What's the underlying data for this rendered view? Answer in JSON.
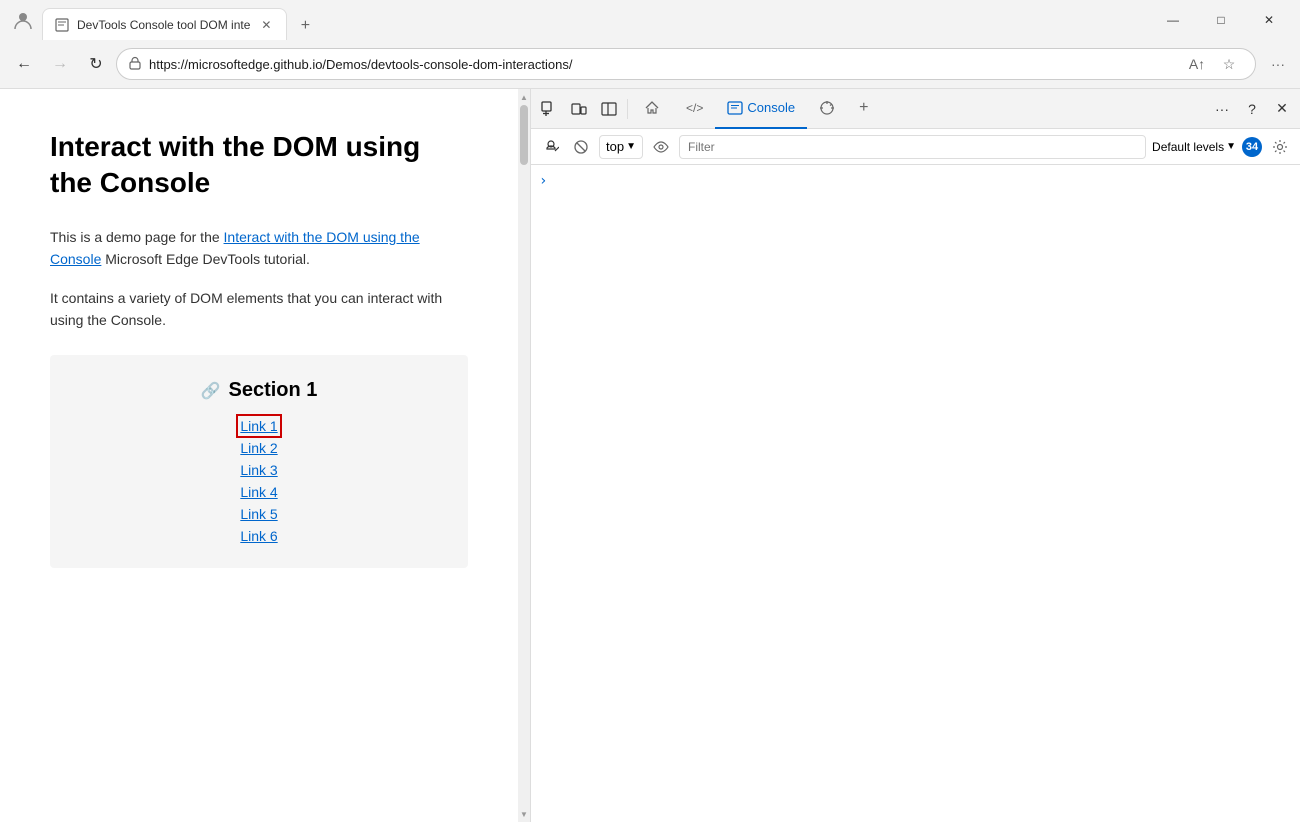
{
  "browser": {
    "tab_title": "DevTools Console tool DOM inte",
    "tab_favicon": "📄",
    "new_tab_icon": "+",
    "window_controls": {
      "minimize": "—",
      "maximize": "□",
      "close": "✕"
    }
  },
  "navbar": {
    "back_label": "←",
    "forward_label": "→",
    "refresh_label": "↻",
    "url": "https://microsoftedge.github.io/Demos/devtools-console-dom-interactions/",
    "url_readable_prefix": "https://",
    "url_domain": "microsoftedge.github.io",
    "url_path": "/Demos/devtools-console-dom-interactions/",
    "read_aloud_icon": "A↑",
    "favorites_icon": "☆",
    "more_icon": "···"
  },
  "webpage": {
    "heading": "Interact with the DOM using the Console",
    "paragraph1_prefix": "This is a demo page for the ",
    "paragraph1_link": "Interact with the DOM using the Console",
    "paragraph1_suffix": " Microsoft Edge DevTools tutorial.",
    "paragraph2": "It contains a variety of DOM elements that you can interact with using the Console.",
    "section1": {
      "title": "Section 1",
      "link_icon": "🔗",
      "links": [
        {
          "label": "Link 1",
          "highlighted": true
        },
        {
          "label": "Link 2",
          "highlighted": false
        },
        {
          "label": "Link 3",
          "highlighted": false
        },
        {
          "label": "Link 4",
          "highlighted": false
        },
        {
          "label": "Link 5",
          "highlighted": false
        },
        {
          "label": "Link 6",
          "highlighted": false
        }
      ]
    }
  },
  "devtools": {
    "toolbar_buttons": [
      {
        "name": "inspect-element",
        "icon": "⬚",
        "tooltip": "Inspect element"
      },
      {
        "name": "device-toolbar",
        "icon": "⬛",
        "tooltip": "Device toolbar"
      },
      {
        "name": "toggle-sidebar",
        "icon": "▭",
        "tooltip": "Toggle sidebar"
      }
    ],
    "tabs": [
      {
        "name": "home",
        "icon": "⌂",
        "label": ""
      },
      {
        "name": "elements",
        "icon": "</>",
        "label": ""
      },
      {
        "name": "console",
        "icon": "▣",
        "label": "Console",
        "active": true
      },
      {
        "name": "sources",
        "icon": "🐛",
        "label": ""
      }
    ],
    "tab_more": "···",
    "tab_add": "+",
    "tab_help": "?",
    "tab_close": "✕",
    "console_toolbar": {
      "clear_icon": "⊘",
      "block_icon": "⊘",
      "top_label": "top",
      "eye_icon": "👁",
      "filter_placeholder": "Filter",
      "levels_label": "Default levels",
      "count": "34",
      "settings_icon": "⚙"
    },
    "console_prompt": ">"
  }
}
